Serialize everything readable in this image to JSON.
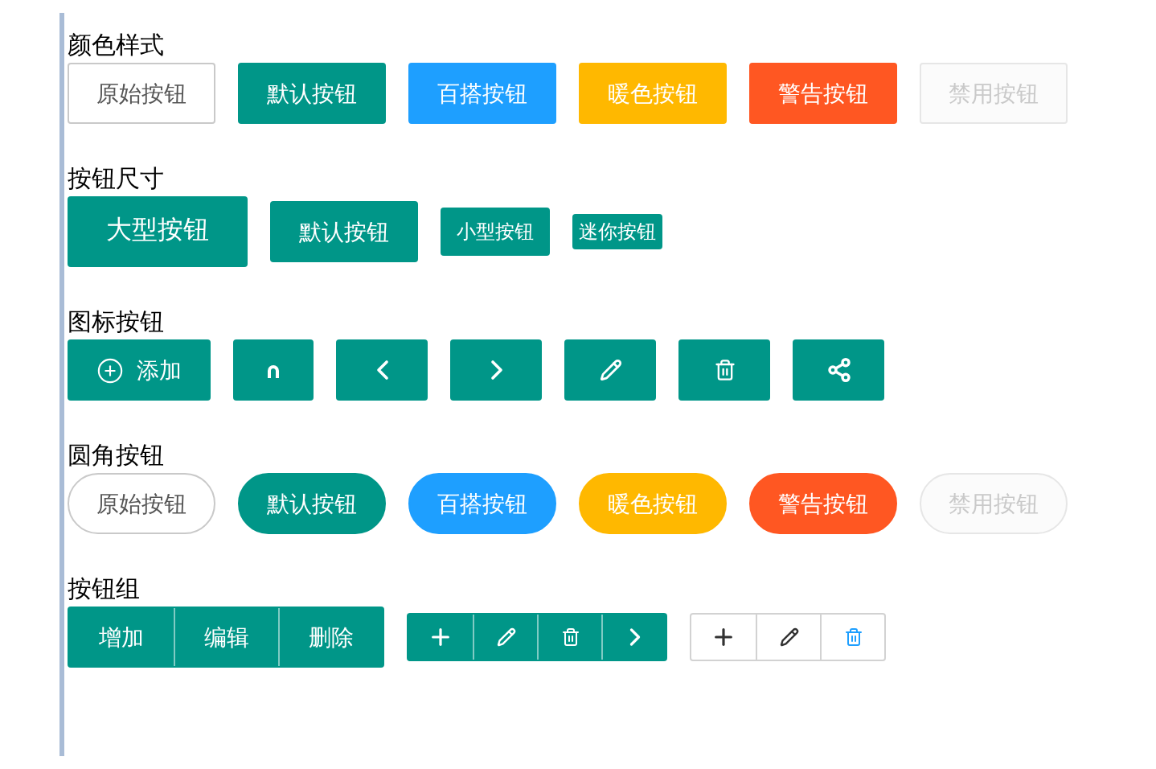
{
  "sections": [
    {
      "title": "颜色样式",
      "kind": "colors",
      "buttons": [
        {
          "label": "原始按钮",
          "color": "#ffffff",
          "disabled": false
        },
        {
          "label": "默认按钮",
          "color": "#009688",
          "disabled": false
        },
        {
          "label": "百搭按钮",
          "color": "#1e9fff",
          "disabled": false
        },
        {
          "label": "暖色按钮",
          "color": "#ffb800",
          "disabled": false
        },
        {
          "label": "警告按钮",
          "color": "#ff5722",
          "disabled": false
        },
        {
          "label": "禁用按钮",
          "color": "#fbfbfb",
          "disabled": true
        }
      ]
    },
    {
      "title": "按钮尺寸",
      "kind": "sizes",
      "buttons": [
        {
          "label": "大型按钮"
        },
        {
          "label": "默认按钮"
        },
        {
          "label": "小型按钮"
        },
        {
          "label": "迷你按钮"
        }
      ]
    },
    {
      "title": "图标按钮",
      "kind": "icons",
      "buttons": [
        {
          "label": "添加"
        }
      ]
    },
    {
      "title": "圆角按钮",
      "kind": "rounded",
      "buttons": [
        {
          "label": "原始按钮",
          "color": "#ffffff",
          "disabled": false
        },
        {
          "label": "默认按钮",
          "color": "#009688",
          "disabled": false
        },
        {
          "label": "百搭按钮",
          "color": "#1e9fff",
          "disabled": false
        },
        {
          "label": "暖色按钮",
          "color": "#ffb800",
          "disabled": false
        },
        {
          "label": "警告按钮",
          "color": "#ff5722",
          "disabled": false
        },
        {
          "label": "禁用按钮",
          "color": "#fbfbfb",
          "disabled": true
        }
      ]
    },
    {
      "title": "按钮组",
      "kind": "groups",
      "groups": [
        {
          "color": "#009688",
          "buttons": [
            {
              "label": "增加"
            },
            {
              "label": "编辑"
            },
            {
              "label": "删除"
            }
          ]
        },
        {
          "color": "#009688"
        },
        {
          "color": "#ffffff"
        }
      ]
    }
  ]
}
